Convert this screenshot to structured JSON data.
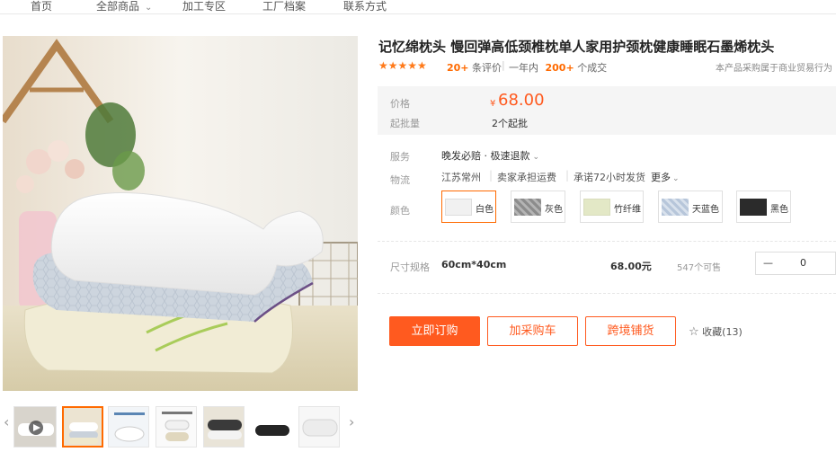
{
  "nav": {
    "items": [
      "首页",
      "全部商品",
      "加工专区",
      "工厂档案",
      "联系方式"
    ]
  },
  "product": {
    "title": "记忆绵枕头 慢回弹高低颈椎枕单人家用护颈枕健康睡眠石墨烯枕头",
    "stars": "★★★★★",
    "reviews_count": "20+",
    "reviews_label": "条评价",
    "sales_prefix": "一年内",
    "sales_count": "200+",
    "sales_label": "个成交",
    "trade_note": "本产品采购属于商业贸易行为"
  },
  "price": {
    "label": "价格",
    "currency": "¥",
    "value": "68.00",
    "moq_label": "起批量",
    "moq_value": "2个起批"
  },
  "service": {
    "label": "服务",
    "value": "晚发必赔 · 极速退款"
  },
  "logistics": {
    "label": "物流",
    "origin": "江苏常州",
    "shipping": "卖家承担运费",
    "promise": "承诺72小时发货",
    "more": "更多"
  },
  "color": {
    "label": "颜色",
    "options": [
      {
        "name": "白色",
        "swatch": "#f1f1f1"
      },
      {
        "name": "灰色",
        "swatch": "#9a9a9a"
      },
      {
        "name": "竹纤维",
        "swatch": "#e3e8c6"
      },
      {
        "name": "天蓝色",
        "swatch": "#c5d2e3"
      },
      {
        "name": "黑色",
        "swatch": "#2b2b2b"
      }
    ]
  },
  "size": {
    "label": "尺寸规格",
    "value": "60cm*40cm",
    "price": "68.00元",
    "stock": "547个可售",
    "qty": "0",
    "minus": "—"
  },
  "actions": {
    "buy": "立即订购",
    "cart": "加采购车",
    "cross": "跨境铺货",
    "fav_icon": "☆",
    "fav": "收藏(13)"
  },
  "colors": {
    "accent": "#ff5a1f",
    "star": "#ff7a1a"
  }
}
